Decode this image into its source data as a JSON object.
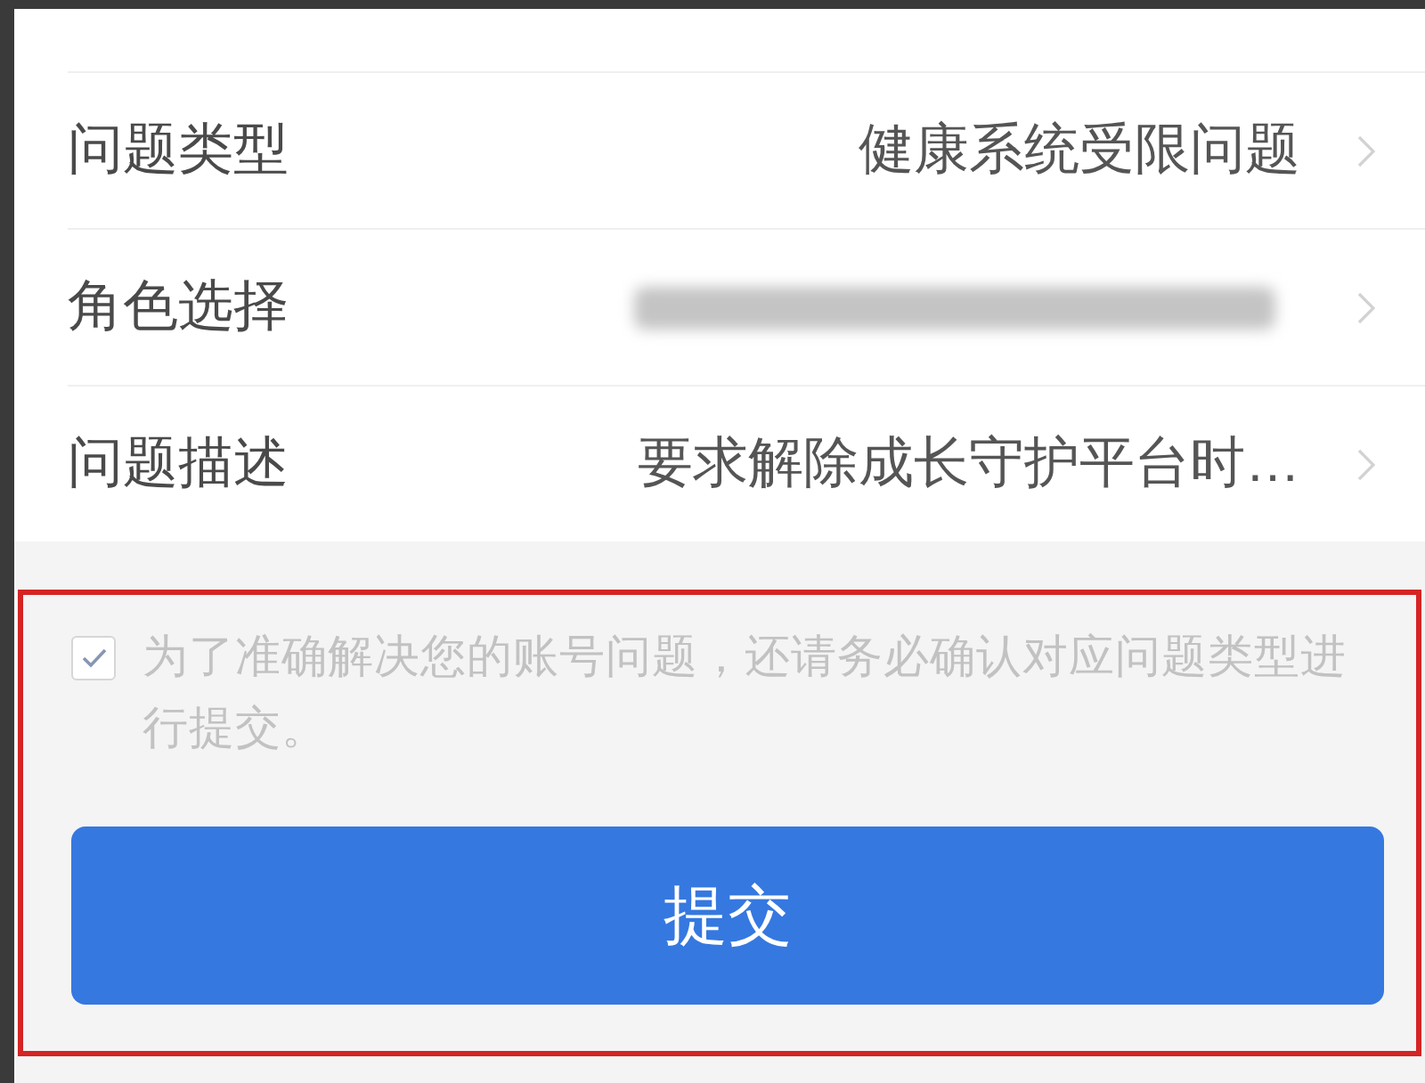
{
  "form": {
    "rows": [
      {
        "label": "问题类型",
        "value": "健康系统受限问题",
        "redacted": false
      },
      {
        "label": "角色选择",
        "redacted": true
      },
      {
        "label": "问题描述",
        "value": "要求解除成长守护平台时…",
        "redacted": false
      }
    ]
  },
  "consent": {
    "checked": true,
    "text": "为了准确解决您的账号问题，还请务必确认对应问题类型进行提交。",
    "highlighted": true
  },
  "submit_button": {
    "label": "提交"
  }
}
